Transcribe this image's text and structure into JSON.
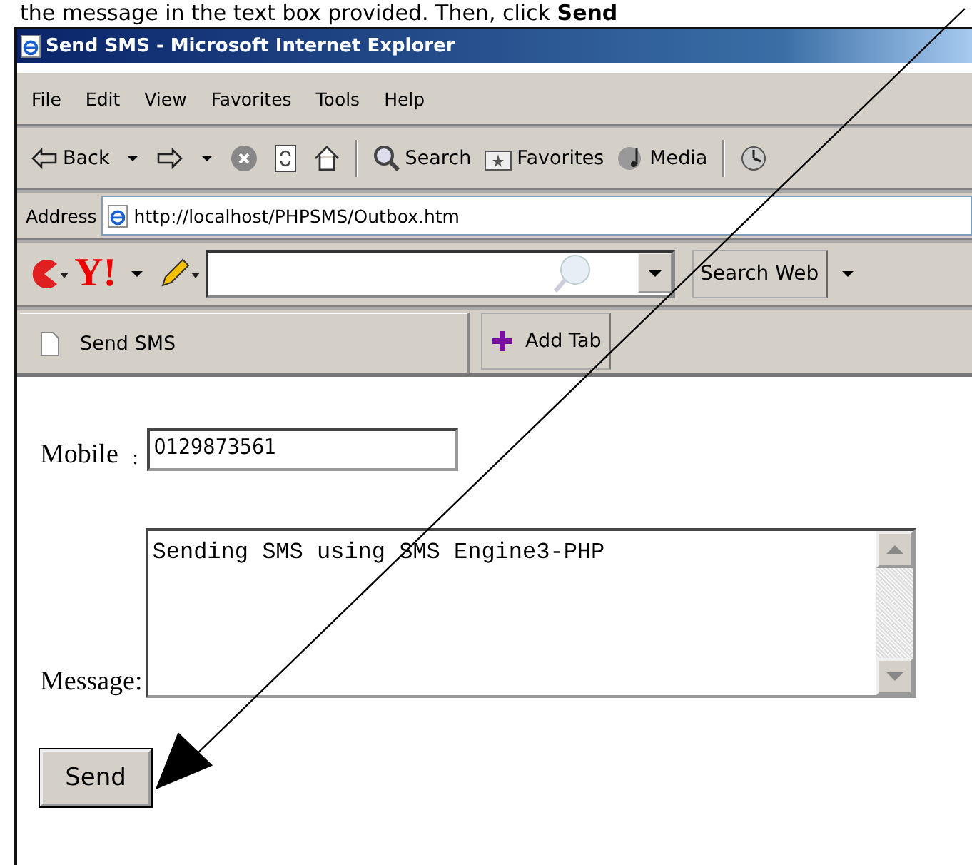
{
  "caption": "the message in the text box provided. Then, click **Send**",
  "window": {
    "title": "Send SMS - Microsoft Internet Explorer"
  },
  "menu": [
    "File",
    "Edit",
    "View",
    "Favorites",
    "Tools",
    "Help"
  ],
  "toolbar": [
    {
      "kind": "back",
      "label": "Back"
    },
    {
      "kind": "forward"
    },
    {
      "kind": "stop"
    },
    {
      "kind": "refresh"
    },
    {
      "kind": "home"
    },
    {
      "kind": "search",
      "label": "Search"
    },
    {
      "kind": "favorites",
      "label": "Favorites"
    },
    {
      "kind": "media",
      "label": "Media"
    },
    {
      "kind": "history"
    }
  ],
  "address": {
    "label": "Address",
    "value": "http://localhost/PHPSMS/Outbox.htm"
  },
  "yahoo_bar": {
    "logo": "Y!",
    "search_button": "Search Web"
  },
  "tabs": [
    {
      "label": "Send SMS",
      "selected": true
    }
  ],
  "add_tab": "Add Tab",
  "form": {
    "mobile_label": "Mobile",
    "separator": ":",
    "mobile_value": "0129873561",
    "message_label": "Message:",
    "message_value": "Sending SMS using SMS Engine3-PHP",
    "send_button": "Send"
  }
}
